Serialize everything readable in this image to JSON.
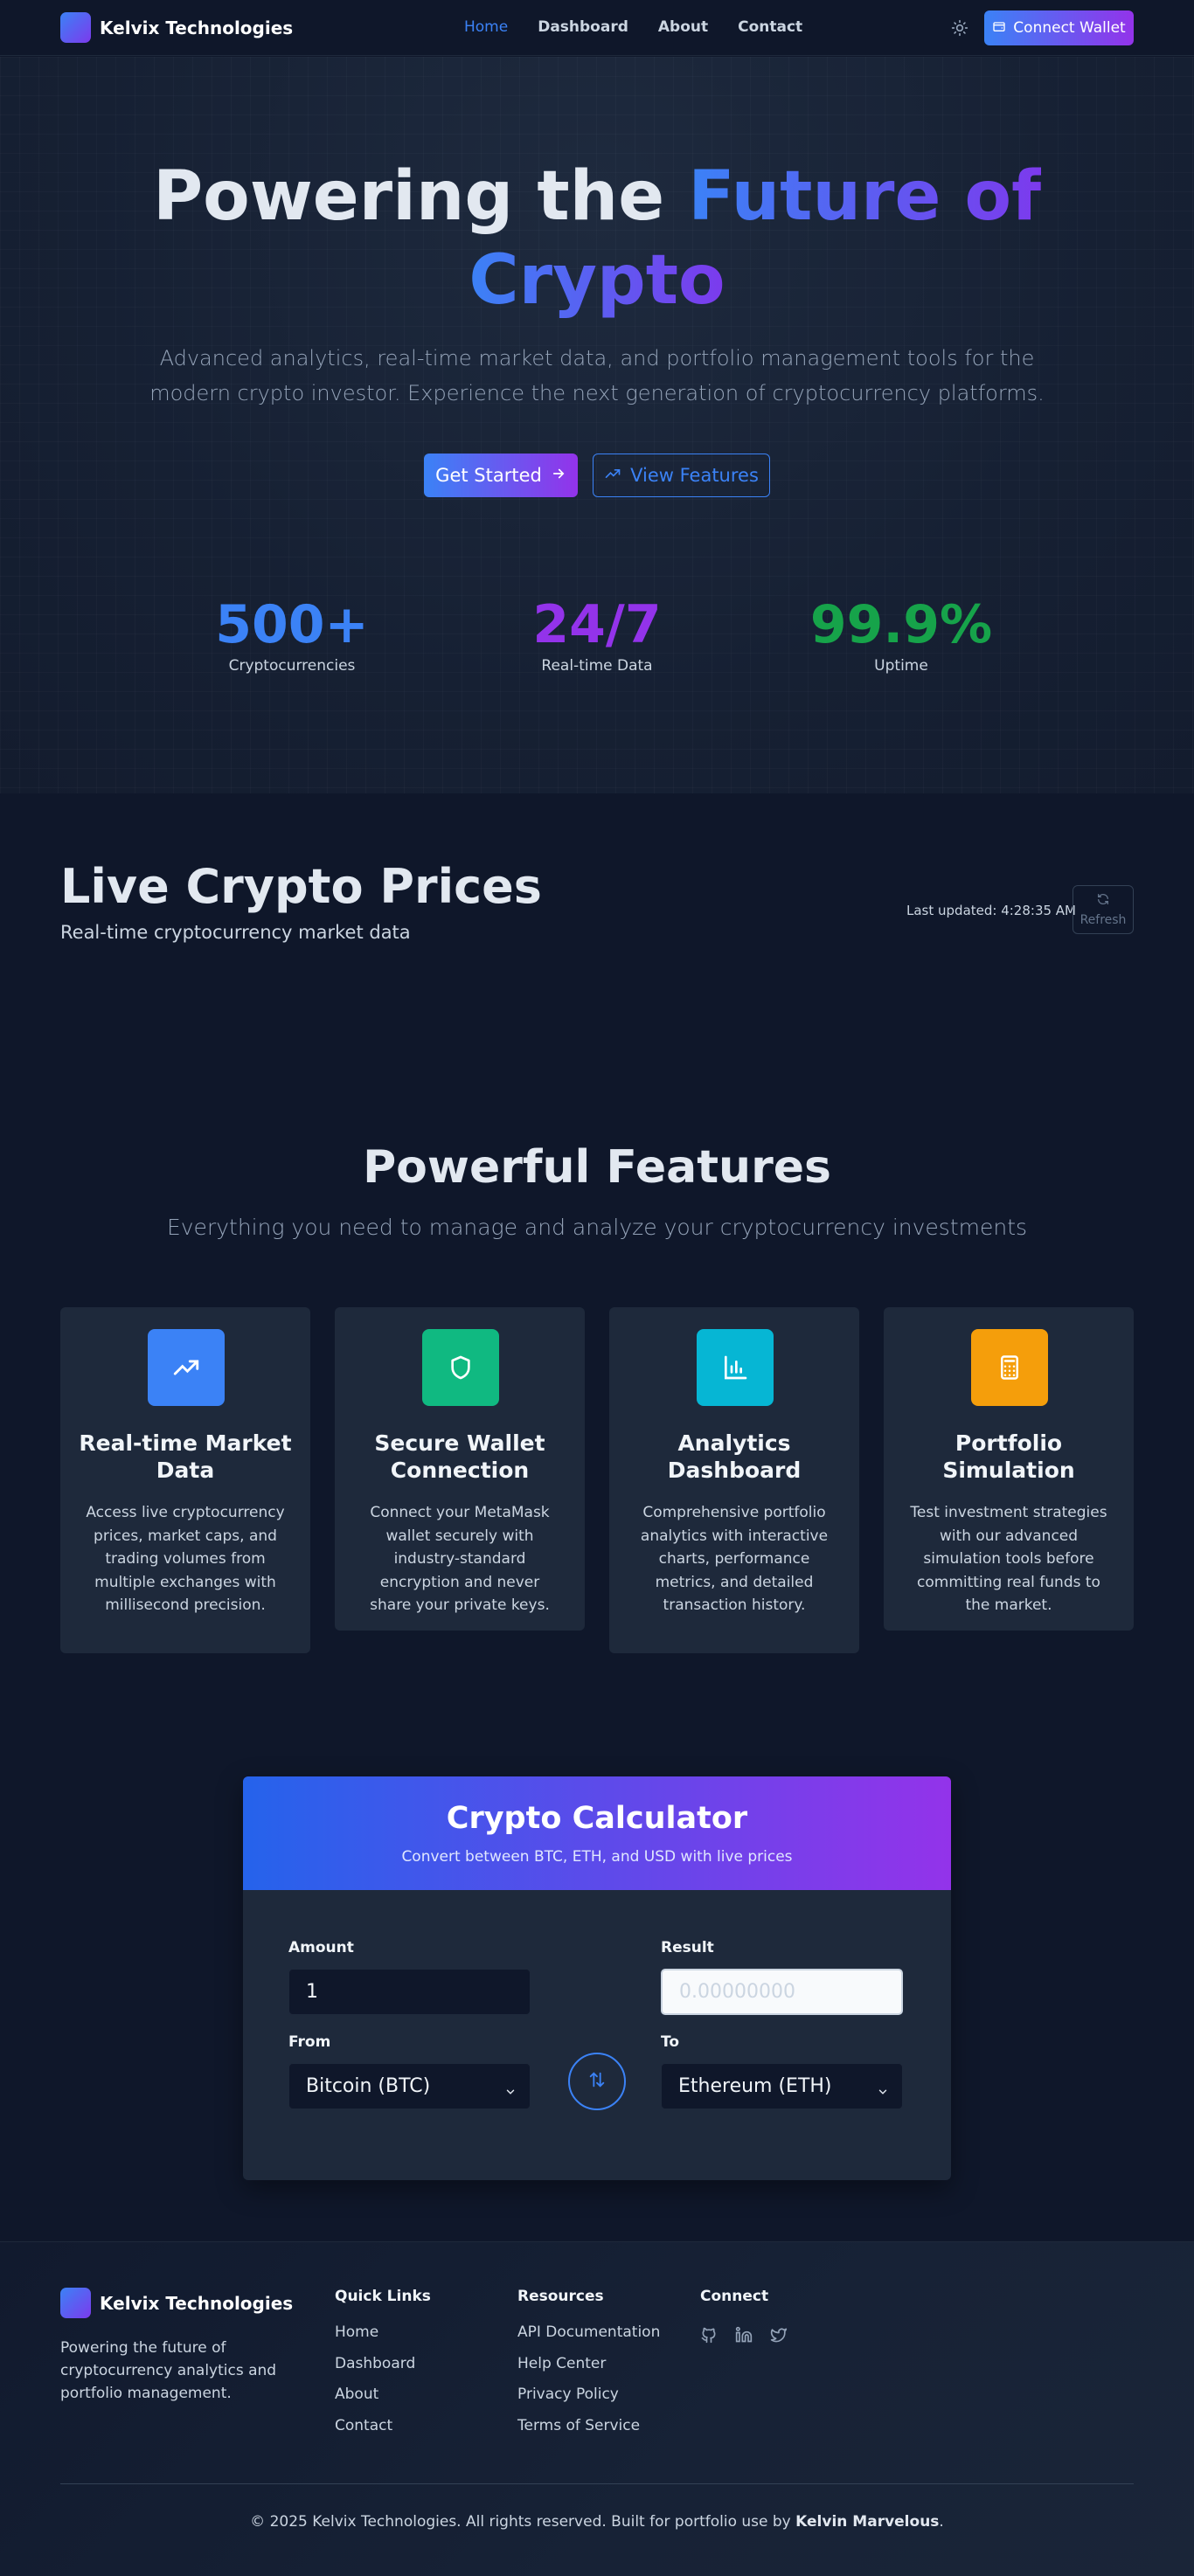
{
  "nav": {
    "brand": "Kelvix Technologies",
    "links": [
      "Home",
      "Dashboard",
      "About",
      "Contact"
    ],
    "active_link": "Home",
    "theme_icon": "sun-icon",
    "connect_label": "Connect Wallet",
    "accent": "#3b82f6"
  },
  "hero": {
    "title_plain": "Powering the",
    "title_gradient_1": "Future of",
    "title_gradient_2": "Crypto",
    "subtitle": "Advanced analytics, real-time market data, and portfolio management tools for the modern crypto investor. Experience the next generation of cryptocurrency platforms.",
    "primary_button": "Get Started",
    "secondary_button": "View Features",
    "stats": [
      {
        "value": "500+",
        "label": "Cryptocurrencies",
        "color": "#3b82f6"
      },
      {
        "value": "24/7",
        "label": "Real-time Data",
        "color": "#9333ea"
      },
      {
        "value": "99.9%",
        "label": "Uptime",
        "color": "#16a34a"
      }
    ]
  },
  "prices": {
    "title": "Live Crypto Prices",
    "subtitle": "Real-time cryptocurrency market data",
    "last_updated": "Last updated: 4:28:35 AM",
    "refresh_label": "Refresh"
  },
  "features": {
    "title": "Powerful Features",
    "subtitle": "Everything you need to manage and analyze your cryptocurrency investments",
    "cards": [
      {
        "title": "Real-time Market Data",
        "desc": "Access live cryptocurrency prices, market caps, and trading volumes from multiple exchanges with millisecond precision.",
        "icon": "trending-up-icon",
        "color": "#3b82f6"
      },
      {
        "title": "Secure Wallet Connection",
        "desc": "Connect your MetaMask wallet securely with industry-standard encryption and never share your private keys.",
        "icon": "shield-icon",
        "color": "#10b981"
      },
      {
        "title": "Analytics Dashboard",
        "desc": "Comprehensive portfolio analytics with interactive charts, performance metrics, and detailed transaction history.",
        "icon": "bar-chart-icon",
        "color": "#06b6d4"
      },
      {
        "title": "Portfolio Simulation",
        "desc": "Test investment strategies with our advanced simulation tools before committing real funds to the market.",
        "icon": "calculator-icon",
        "color": "#f59e0b"
      }
    ]
  },
  "calculator": {
    "title": "Crypto Calculator",
    "subtitle": "Convert between BTC, ETH, and USD with live prices",
    "amount_label": "Amount",
    "amount_value": "1",
    "result_label": "Result",
    "result_placeholder": "0.00000000",
    "from_label": "From",
    "from_value": "Bitcoin (BTC)",
    "to_label": "To",
    "to_value": "Ethereum (ETH)"
  },
  "footer": {
    "brand": "Kelvix Technologies",
    "desc": "Powering the future of cryptocurrency analytics and portfolio management.",
    "quick_links_title": "Quick Links",
    "quick_links": [
      "Home",
      "Dashboard",
      "About",
      "Contact"
    ],
    "resources_title": "Resources",
    "resources": [
      "API Documentation",
      "Help Center",
      "Privacy Policy",
      "Terms of Service"
    ],
    "connect_title": "Connect",
    "social_icons": [
      "github-icon",
      "linkedin-icon",
      "twitter-icon"
    ],
    "copyright": "© 2025 Kelvix Technologies. All rights reserved. Built for portfolio use by",
    "author": "Kelvin Marvelous",
    "period": "."
  }
}
